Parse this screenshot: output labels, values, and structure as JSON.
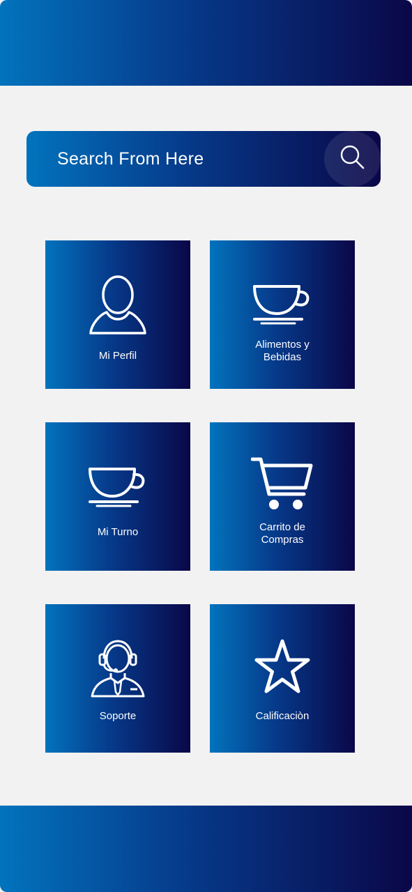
{
  "search": {
    "placeholder": "Search From Here",
    "icon": "search-icon"
  },
  "tiles": [
    {
      "label": "Mi Perfil",
      "icon": "user-icon"
    },
    {
      "label": "Alimentos y\nBebidas",
      "icon": "cup-icon"
    },
    {
      "label": "Mi Turno",
      "icon": "cup-icon"
    },
    {
      "label": "Carrito de\nCompras",
      "icon": "shopping-cart-icon"
    },
    {
      "label": "Soporte",
      "icon": "support-agent-icon"
    },
    {
      "label": "Calificaciòn",
      "icon": "star-icon"
    }
  ],
  "colors": {
    "gradient_start": "#0273bd",
    "gradient_mid": "#063a8a",
    "gradient_end": "#0a0748",
    "background": "#f2f2f2",
    "text": "#ffffff"
  }
}
